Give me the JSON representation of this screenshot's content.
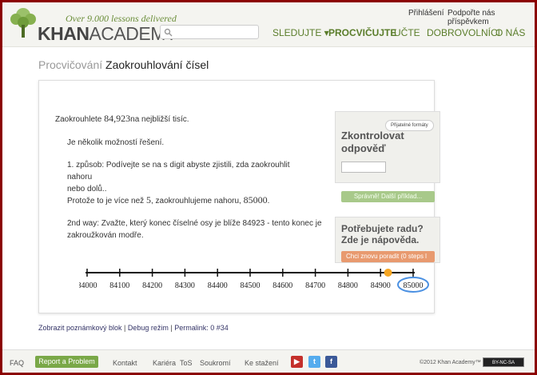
{
  "header": {
    "tagline": "Over 9.000 lessons delivered",
    "brand_bold": "KHAN",
    "brand_rest": "ACADEMY",
    "top_links": [
      "Přihlášení",
      "Podpořte nás příspěvkem"
    ],
    "search": {
      "placeholder": ""
    },
    "nav": [
      {
        "label": "SLEDUJTE ▾"
      },
      {
        "label": "PROCVIČUJTE"
      },
      {
        "label": "UČTE"
      },
      {
        "label": "DOBROVOLNÍCI"
      },
      {
        "label": "O NÁS"
      }
    ]
  },
  "page": {
    "breadcrumb": "Procvičování",
    "title": "Zaokrouhlování čísel"
  },
  "question": {
    "prompt_before": "Zaokrouhlete ",
    "prompt_number": "84,923",
    "prompt_after": "na nejbližší tisíc.",
    "intro": "Je několik možností řešení.",
    "method1": "1. způsob: Podívejte se na s digit  abyste zjistili, zda zaokrouhlit nahoru nebo dolů..",
    "method1_line2": "nebo dolů..",
    "because_before": "Protože to je více než ",
    "because_digit": "5",
    "because_middle": ", zaokrouhlujeme nahoru, ",
    "because_result": "85000",
    "because_end": ".",
    "method2_line1": "2nd way: Zvažte, který konec číselné osy je blíže 84923 - tento konec je",
    "method2_line2": "zakroužkován modře."
  },
  "number_line": {
    "ticks": [
      "84000",
      "84100",
      "84200",
      "84300",
      "84400",
      "84500",
      "84600",
      "84700",
      "84800",
      "84900",
      "85000"
    ],
    "marked_value": 84923,
    "circled_value": "85000",
    "marker_color": "#f5a623",
    "circle_color": "#4a90e2"
  },
  "answer_box": {
    "formats_button": "Přijatelné formáty",
    "title_line1": "Zkontrolovat",
    "title_line2": "odpověď",
    "input_value": "",
    "check_button": "Správně! Další příklad..."
  },
  "help_box": {
    "title_line1": "Potřebujete radu?",
    "title_line2": "Zde je nápověda.",
    "hint_button": "Chci znovu poradit (0 steps l"
  },
  "debug": {
    "link1": "Zobrazit poznámkový blok",
    "sep": " | ",
    "link2": "Debug režim",
    "link3": "Permalink: 0 #34"
  },
  "footer": {
    "faq": "FAQ",
    "report": "Report a Problem",
    "links": [
      "Kontakt",
      "Kariéra",
      "ToS",
      "Soukromí",
      "Ke stažení"
    ],
    "copyright": "©2012 Khan Academy™",
    "license": "BY-NC-SA"
  },
  "colors": {
    "brand_green": "#5a7d2a",
    "frame": "#8b0000"
  }
}
